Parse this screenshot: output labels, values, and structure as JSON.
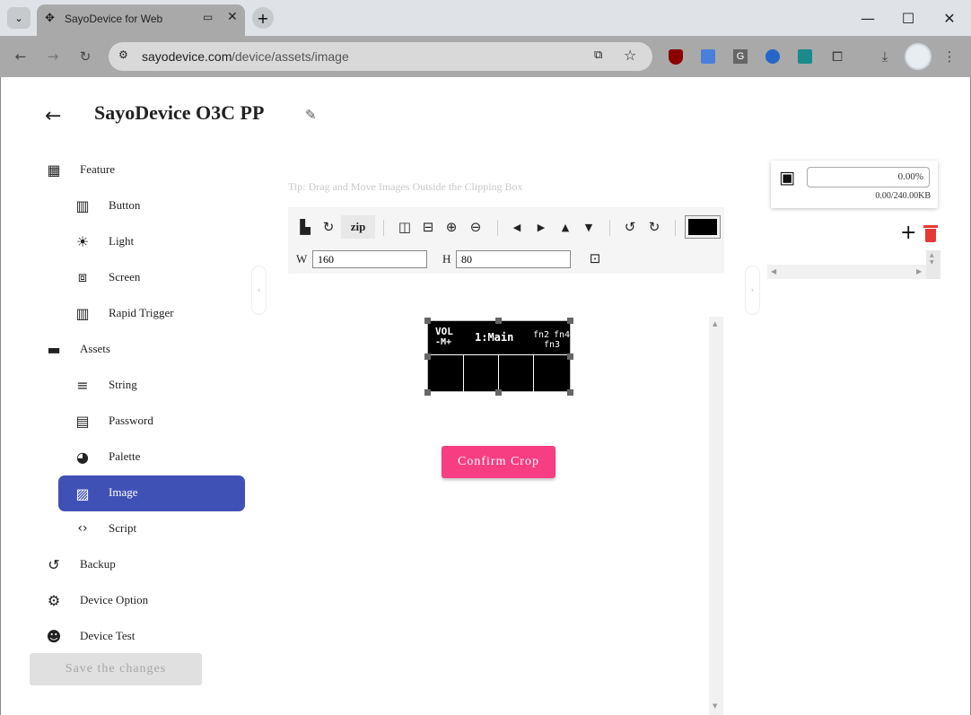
{
  "browser": {
    "tab_title": "SayoDevice for Web",
    "url_host": "sayodevice.com",
    "url_path": "/device/assets/image"
  },
  "app": {
    "device_name": "SayoDevice O3C PP",
    "tip": "Tip: Drag and Move Images Outside the Clipping Box",
    "save_changes": "Save the changes",
    "confirm_crop": "Confirm Crop",
    "nav": [
      {
        "label": "Feature",
        "icon": "grid-icon"
      },
      {
        "label": "Button",
        "icon": "piano-keys-icon"
      },
      {
        "label": "Light",
        "icon": "sun-icon"
      },
      {
        "label": "Screen",
        "icon": "screen-icon"
      },
      {
        "label": "Rapid Trigger",
        "icon": "piano-keys-icon"
      },
      {
        "label": "Assets",
        "icon": "folder-icon"
      },
      {
        "label": "String",
        "icon": "edit-text-icon"
      },
      {
        "label": "Password",
        "icon": "library-icon"
      },
      {
        "label": "Palette",
        "icon": "palette-icon"
      },
      {
        "label": "Image",
        "icon": "image-icon",
        "active": true
      },
      {
        "label": "Script",
        "icon": "code-icon"
      },
      {
        "label": "Backup",
        "icon": "restore-icon"
      },
      {
        "label": "Device Option",
        "icon": "settings-cog-icon"
      },
      {
        "label": "Device Test",
        "icon": "engineer-icon"
      }
    ],
    "editor": {
      "zip_label": "zip",
      "w_label": "W",
      "h_label": "H",
      "w_value": "160",
      "h_value": "80",
      "color_swatch": "#000000"
    },
    "storage": {
      "percent": "0.00%",
      "usage": "0.00/240.00KB"
    },
    "preview": {
      "vol_top": "VOL",
      "vol_bottom": "-M+",
      "main": "1:Main",
      "fn2": "fn2",
      "fn4": "fn4",
      "fn3": "fn3"
    },
    "colors": {
      "accent": "#3f51b5",
      "confirm": "#f73e83",
      "delete": "#e53935"
    }
  }
}
